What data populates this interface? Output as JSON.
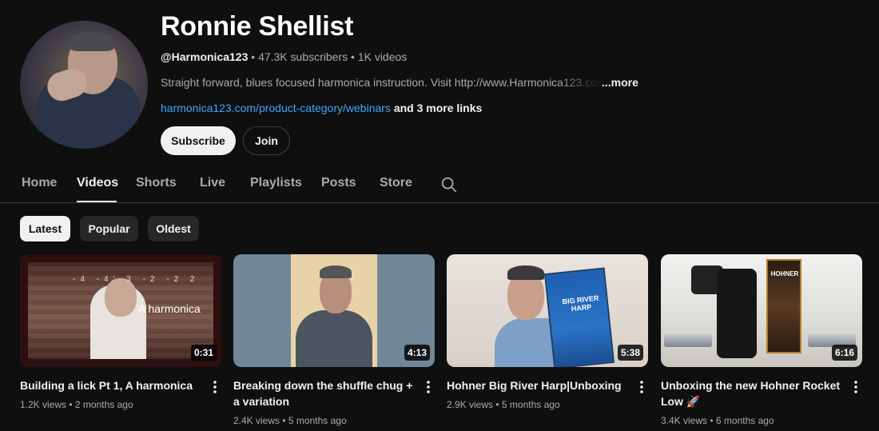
{
  "channel": {
    "name": "Ronnie Shellist",
    "handle": "@Harmonica123",
    "subscribers": "47.3K subscribers",
    "videos_count": "1K videos",
    "separator": "•",
    "description": "Straight forward, blues focused harmonica instruction. Visit http://www.Harmonica123.com",
    "more_label": "...more",
    "link": "harmonica123.com/product-category/webinars",
    "more_links": "and 3 more links",
    "subscribe_label": "Subscribe",
    "join_label": "Join"
  },
  "tabs": [
    {
      "label": "Home"
    },
    {
      "label": "Videos"
    },
    {
      "label": "Shorts"
    },
    {
      "label": "Live"
    },
    {
      "label": "Playlists"
    },
    {
      "label": "Posts"
    },
    {
      "label": "Store"
    }
  ],
  "active_tab": "Videos",
  "chips": [
    {
      "label": "Latest"
    },
    {
      "label": "Popular"
    },
    {
      "label": "Oldest"
    }
  ],
  "active_chip": "Latest",
  "videos": [
    {
      "title": "Building a lick Pt 1, A harmonica",
      "views": "1.2K views",
      "age": "2 months ago",
      "duration": "0:31",
      "thumb_notes": "-4  -4'  3  -2  -2  2",
      "thumb_text": "A harmonica"
    },
    {
      "title": "Breaking down the shuffle chug + a variation",
      "views": "2.4K views",
      "age": "5 months ago",
      "duration": "4:13"
    },
    {
      "title": "Hohner Big River Harp|Unboxing",
      "views": "2.9K views",
      "age": "5 months ago",
      "duration": "5:38",
      "thumb_text": "BIG RIVER HARP"
    },
    {
      "title": "Unboxing the new Hohner Rocket Low 🚀",
      "views": "3.4K views",
      "age": "6 months ago",
      "duration": "6:16",
      "thumb_text": "HOHNER"
    }
  ],
  "colors": {
    "background": "#0f0f0f",
    "text": "#f1f1f1",
    "muted": "#aaaaaa",
    "link": "#3ea6ff",
    "chip": "#272727"
  }
}
